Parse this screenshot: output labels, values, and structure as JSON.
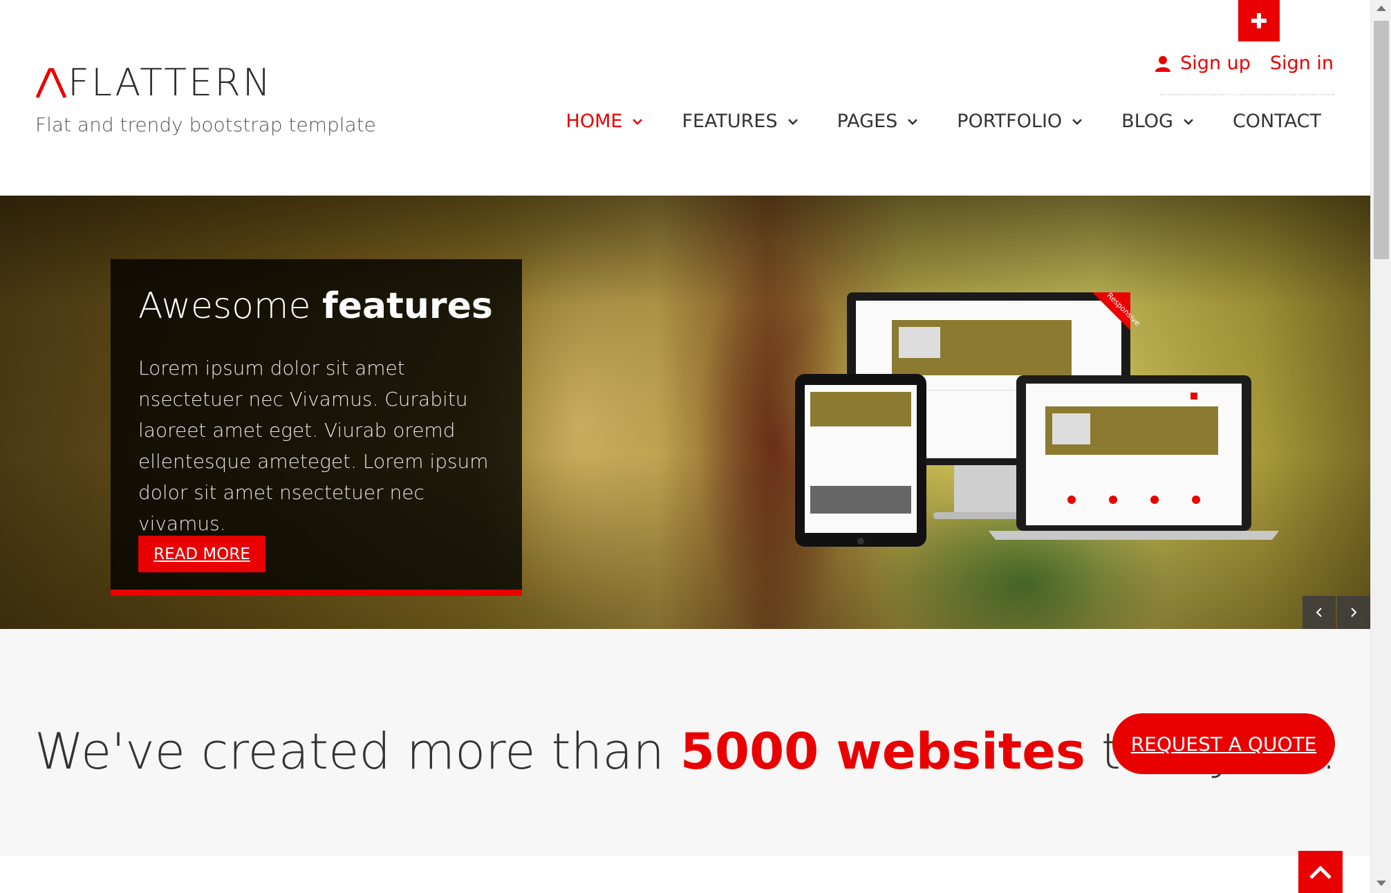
{
  "brand": {
    "logo_text": "FLATTERN",
    "tagline": "Flat and trendy bootstrap template",
    "accent_color": "#e90000"
  },
  "top_tab": {
    "icon": "plus-icon"
  },
  "user_links": {
    "signup": "Sign up",
    "signin": "Sign in",
    "icon": "user-icon"
  },
  "nav": {
    "items": [
      {
        "label": "HOME",
        "active": true,
        "has_dropdown": true
      },
      {
        "label": "FEATURES",
        "active": false,
        "has_dropdown": true
      },
      {
        "label": "PAGES",
        "active": false,
        "has_dropdown": true
      },
      {
        "label": "PORTFOLIO",
        "active": false,
        "has_dropdown": true
      },
      {
        "label": "BLOG",
        "active": false,
        "has_dropdown": true
      },
      {
        "label": "CONTACT",
        "active": false,
        "has_dropdown": false
      }
    ]
  },
  "hero": {
    "title_light": "Awesome",
    "title_bold": "features",
    "text": "Lorem ipsum dolor sit amet nsectetuer nec Vivamus. Curabitu laoreet amet eget. Viurab oremd ellentesque ameteget. Lorem ipsum dolor sit amet nsectetuer nec vivamus.",
    "button": "READ MORE",
    "ribbon": "Responsive"
  },
  "slider": {
    "prev_icon": "chevron-left-icon",
    "next_icon": "chevron-right-icon"
  },
  "cta": {
    "text_before": "We've created more than ",
    "highlight": "5000 websites",
    "text_after": " this year!",
    "button": "REQUEST A QUOTE"
  },
  "back_to_top": {
    "icon": "chevron-up-icon"
  }
}
